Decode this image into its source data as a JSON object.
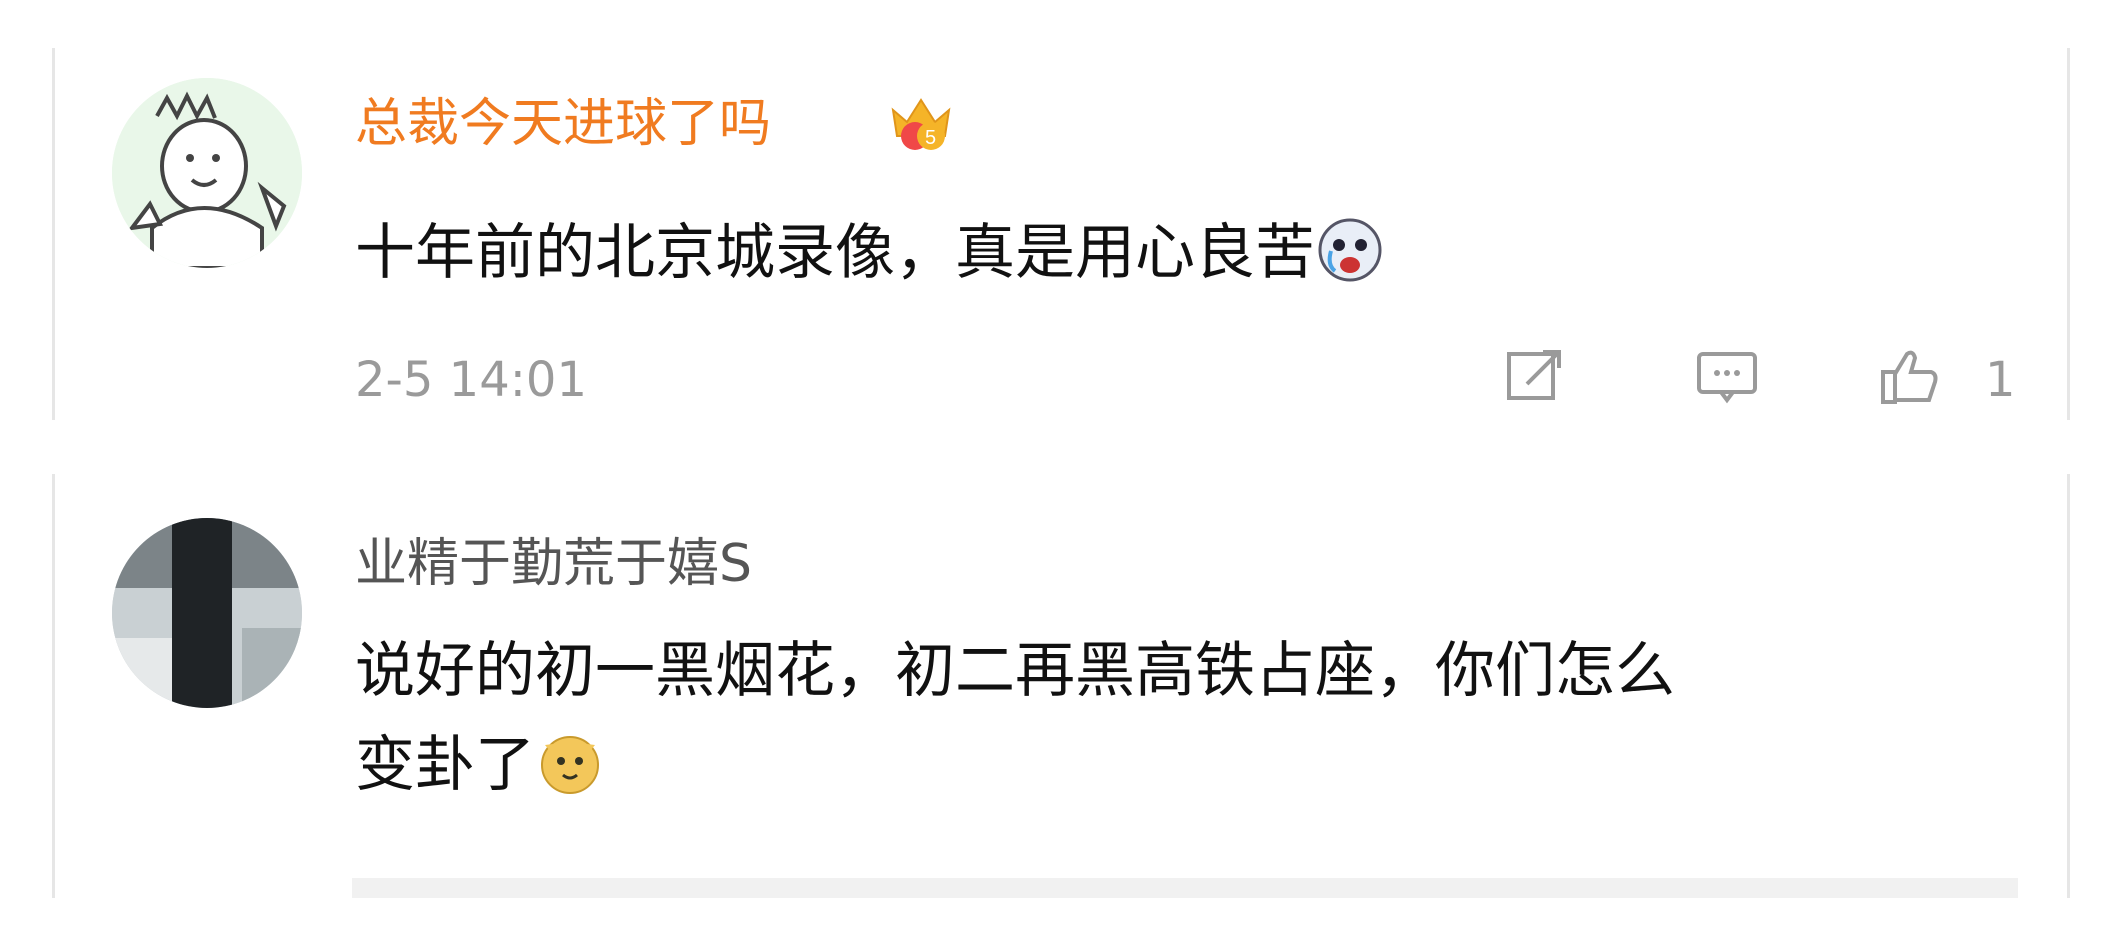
{
  "comments": [
    {
      "username": "总裁今天进球了吗",
      "username_color": "#f07b20",
      "badge_icon": "vip-crown-icon",
      "avatar_icon": "cartoon-avatar-icon",
      "text": "十年前的北京城录像，真是用心良苦",
      "trailing_emoji": "tearful-laugh-emoji",
      "timestamp": "2-5 14:01",
      "actions": {
        "share_icon": "share-icon",
        "comment_icon": "comment-icon",
        "like_icon": "thumbs-up-icon",
        "like_count": "1"
      }
    },
    {
      "username": "业精于勤荒于嬉S",
      "username_color": "#555555",
      "avatar_icon": "photo-avatar-icon",
      "text_line1": "说好的初一黑烟花，初二再黑高铁占座，你们怎么",
      "text_line2": "变卦了",
      "trailing_emoji": "doge-emoji"
    }
  ]
}
